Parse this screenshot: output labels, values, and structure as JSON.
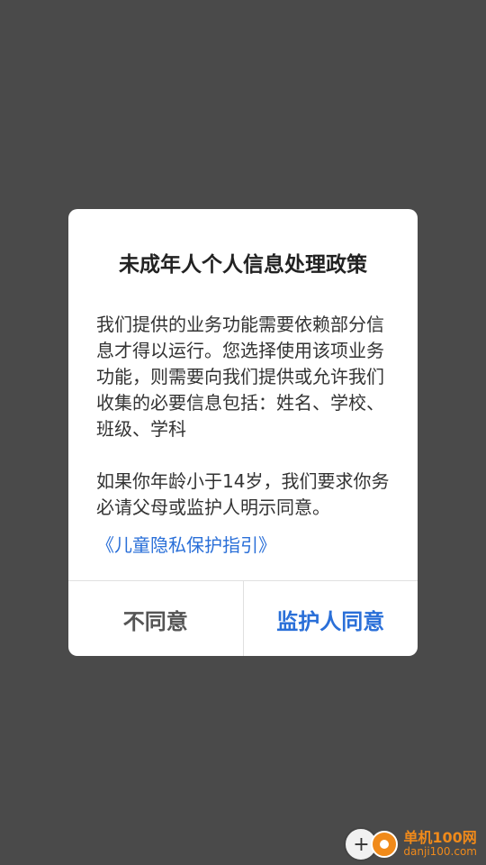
{
  "dialog": {
    "title": "未成年人个人信息处理政策",
    "paragraph1": "我们提供的业务功能需要依赖部分信息才得以运行。您选择使用该项业务功能，则需要向我们提供或允许我们收集的必要信息包括：姓名、学校、班级、学科",
    "paragraph2": "如果你年龄小于14岁，我们要求你务必请父母或监护人明示同意。",
    "link_text": "《儿童隐私保护指引》",
    "disagree_label": "不同意",
    "agree_label": "监护人同意"
  },
  "watermark": {
    "brand": "单机100网",
    "domain": "danji100.com"
  },
  "colors": {
    "overlay": "#4a4a4a",
    "accent": "#2a6fd8",
    "watermark": "#f08a1a"
  }
}
